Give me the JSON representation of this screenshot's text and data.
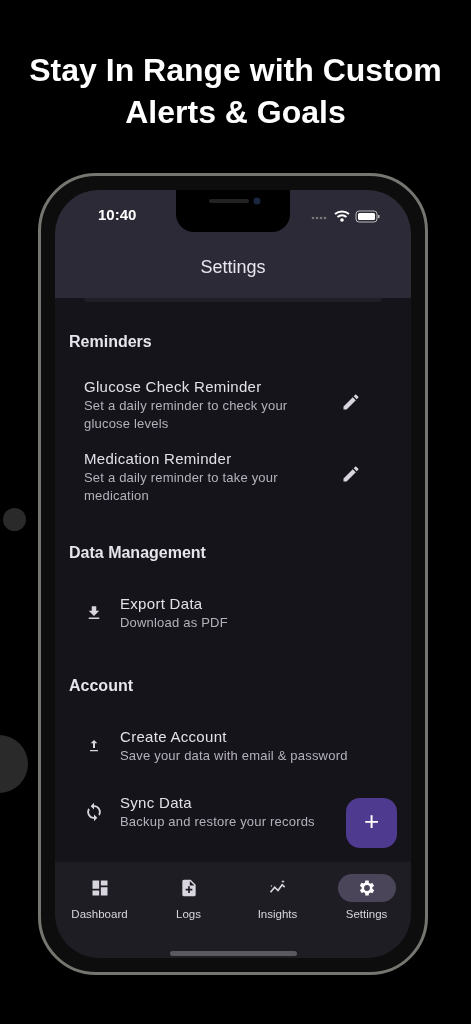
{
  "headline": "Stay In Range with Custom Alerts & Goals",
  "status_bar": {
    "time": "10:40"
  },
  "app_bar": {
    "title": "Settings"
  },
  "sections": [
    {
      "title": "Reminders",
      "items": [
        {
          "kind": "edit",
          "title": "Glucose Check Reminder",
          "subtitle": "Set a daily reminder to check your glucose levels"
        },
        {
          "kind": "edit",
          "title": "Medication Reminder",
          "subtitle": "Set a daily reminder to take your medication"
        }
      ]
    },
    {
      "title": "Data Management",
      "items": [
        {
          "kind": "download",
          "title": "Export Data",
          "subtitle": "Download as PDF"
        }
      ]
    },
    {
      "title": "Account",
      "items": [
        {
          "kind": "upload",
          "title": "Create Account",
          "subtitle": "Save your data with email & password"
        },
        {
          "kind": "sync",
          "title": "Sync Data",
          "subtitle": "Backup and restore your records"
        }
      ]
    }
  ],
  "fab": {
    "label": "+"
  },
  "bottom_nav": [
    {
      "kind": "dashboard",
      "label": "Dashboard",
      "selected": false
    },
    {
      "kind": "logs",
      "label": "Logs",
      "selected": false
    },
    {
      "kind": "insights",
      "label": "Insights",
      "selected": false
    },
    {
      "kind": "settings",
      "label": "Settings",
      "selected": true
    }
  ]
}
